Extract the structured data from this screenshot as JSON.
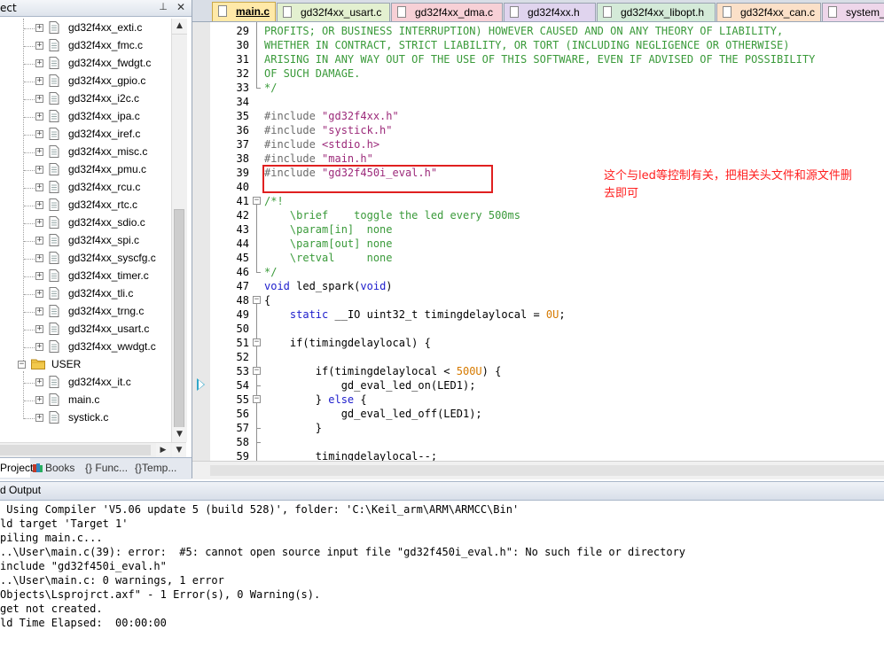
{
  "project_panel": {
    "title": "ect",
    "files": [
      {
        "name": "gd32f4xx_exti.c"
      },
      {
        "name": "gd32f4xx_fmc.c"
      },
      {
        "name": "gd32f4xx_fwdgt.c"
      },
      {
        "name": "gd32f4xx_gpio.c"
      },
      {
        "name": "gd32f4xx_i2c.c"
      },
      {
        "name": "gd32f4xx_ipa.c"
      },
      {
        "name": "gd32f4xx_iref.c"
      },
      {
        "name": "gd32f4xx_misc.c"
      },
      {
        "name": "gd32f4xx_pmu.c"
      },
      {
        "name": "gd32f4xx_rcu.c"
      },
      {
        "name": "gd32f4xx_rtc.c"
      },
      {
        "name": "gd32f4xx_sdio.c"
      },
      {
        "name": "gd32f4xx_spi.c"
      },
      {
        "name": "gd32f4xx_syscfg.c"
      },
      {
        "name": "gd32f4xx_timer.c"
      },
      {
        "name": "gd32f4xx_tli.c"
      },
      {
        "name": "gd32f4xx_trng.c"
      },
      {
        "name": "gd32f4xx_usart.c"
      },
      {
        "name": "gd32f4xx_wwdgt.c"
      }
    ],
    "group": {
      "name": "USER",
      "files": [
        {
          "name": "gd32f4xx_it.c"
        },
        {
          "name": "main.c"
        },
        {
          "name": "systick.c"
        }
      ]
    },
    "tabs": [
      {
        "label": "Project"
      },
      {
        "label": "Books"
      },
      {
        "label": "Func..."
      },
      {
        "label": "Temp..."
      }
    ]
  },
  "editor_tabs": [
    {
      "label": "main.c",
      "color": "#ffe9a8"
    },
    {
      "label": "gd32f4xx_usart.c",
      "color": "#e3f0d0"
    },
    {
      "label": "gd32f4xx_dma.c",
      "color": "#f7d0d6"
    },
    {
      "label": "gd32f4xx.h",
      "color": "#e0d4ee"
    },
    {
      "label": "gd32f4xx_libopt.h",
      "color": "#d4ead8"
    },
    {
      "label": "gd32f4xx_can.c",
      "color": "#fbe0c8"
    },
    {
      "label": "system_",
      "color": "#eed6ea"
    }
  ],
  "code": {
    "lines": [
      {
        "n": "29",
        "segments": [
          {
            "t": "PROFITS; OR BUSINESS INTERRUPTION) HOWEVER CAUSED AND ON ANY THEORY OF LIABILITY,",
            "c": "c-comment"
          }
        ]
      },
      {
        "n": "30",
        "segments": [
          {
            "t": "WHETHER IN CONTRACT, STRICT LIABILITY, OR TORT (INCLUDING NEGLIGENCE OR OTHERWISE)",
            "c": "c-comment"
          }
        ]
      },
      {
        "n": "31",
        "segments": [
          {
            "t": "ARISING IN ANY WAY OUT OF THE USE OF THIS SOFTWARE, EVEN IF ADVISED OF THE POSSIBILITY",
            "c": "c-comment"
          }
        ]
      },
      {
        "n": "32",
        "segments": [
          {
            "t": "OF SUCH DAMAGE.",
            "c": "c-comment"
          }
        ]
      },
      {
        "n": "33",
        "segments": [
          {
            "t": "*/",
            "c": "c-comment"
          }
        ]
      },
      {
        "n": "34",
        "segments": []
      },
      {
        "n": "35",
        "segments": [
          {
            "t": "#include ",
            "c": "c-pre"
          },
          {
            "t": "\"gd32f4xx.h\"",
            "c": "c-str"
          }
        ]
      },
      {
        "n": "36",
        "segments": [
          {
            "t": "#include ",
            "c": "c-pre"
          },
          {
            "t": "\"systick.h\"",
            "c": "c-str"
          }
        ]
      },
      {
        "n": "37",
        "segments": [
          {
            "t": "#include ",
            "c": "c-pre"
          },
          {
            "t": "<stdio.h>",
            "c": "c-str"
          }
        ]
      },
      {
        "n": "38",
        "segments": [
          {
            "t": "#include ",
            "c": "c-pre"
          },
          {
            "t": "\"main.h\"",
            "c": "c-str"
          }
        ]
      },
      {
        "n": "39",
        "segments": [
          {
            "t": "#include ",
            "c": "c-pre"
          },
          {
            "t": "\"gd32f450i_eval.h\"",
            "c": "c-str"
          }
        ]
      },
      {
        "n": "40",
        "segments": []
      },
      {
        "n": "41",
        "segments": [
          {
            "t": "/*!",
            "c": "c-comment"
          }
        ]
      },
      {
        "n": "42",
        "segments": [
          {
            "t": "    \\brief    toggle the led every 500ms",
            "c": "c-comment"
          }
        ]
      },
      {
        "n": "43",
        "segments": [
          {
            "t": "    \\param[in]  none",
            "c": "c-comment"
          }
        ]
      },
      {
        "n": "44",
        "segments": [
          {
            "t": "    \\param[out] none",
            "c": "c-comment"
          }
        ]
      },
      {
        "n": "45",
        "segments": [
          {
            "t": "    \\retval     none",
            "c": "c-comment"
          }
        ]
      },
      {
        "n": "46",
        "segments": [
          {
            "t": "*/",
            "c": "c-comment"
          }
        ]
      },
      {
        "n": "47",
        "segments": [
          {
            "t": "void",
            "c": "c-kw"
          },
          {
            "t": " led_spark(",
            "c": "c-plain"
          },
          {
            "t": "void",
            "c": "c-kw"
          },
          {
            "t": ")",
            "c": "c-plain"
          }
        ]
      },
      {
        "n": "48",
        "segments": [
          {
            "t": "{",
            "c": "c-plain"
          }
        ]
      },
      {
        "n": "49",
        "segments": [
          {
            "t": "    ",
            "c": "c-plain"
          },
          {
            "t": "static",
            "c": "c-kw"
          },
          {
            "t": " __IO uint32_t timingdelaylocal = ",
            "c": "c-plain"
          },
          {
            "t": "0U",
            "c": "c-num"
          },
          {
            "t": ";",
            "c": "c-plain"
          }
        ]
      },
      {
        "n": "50",
        "segments": []
      },
      {
        "n": "51",
        "segments": [
          {
            "t": "    if(timingdelaylocal) {",
            "c": "c-plain"
          }
        ]
      },
      {
        "n": "52",
        "segments": []
      },
      {
        "n": "53",
        "segments": [
          {
            "t": "        if(timingdelaylocal < ",
            "c": "c-plain"
          },
          {
            "t": "500U",
            "c": "c-num"
          },
          {
            "t": ") {",
            "c": "c-plain"
          }
        ]
      },
      {
        "n": "54",
        "segments": [
          {
            "t": "            gd_eval_led_on(LED1);",
            "c": "c-plain"
          }
        ]
      },
      {
        "n": "55",
        "segments": [
          {
            "t": "        } ",
            "c": "c-plain"
          },
          {
            "t": "else",
            "c": "c-kw"
          },
          {
            "t": " {",
            "c": "c-plain"
          }
        ]
      },
      {
        "n": "56",
        "segments": [
          {
            "t": "            gd_eval_led_off(LED1);",
            "c": "c-plain"
          }
        ]
      },
      {
        "n": "57",
        "segments": [
          {
            "t": "        }",
            "c": "c-plain"
          }
        ]
      },
      {
        "n": "58",
        "segments": []
      },
      {
        "n": "59",
        "segments": [
          {
            "t": "        timingdelaylocal--;",
            "c": "c-plain"
          }
        ]
      }
    ]
  },
  "annotation": {
    "text": "这个与led等控制有关，把相关头文件和源文件删去即可"
  },
  "build_output": {
    "title": "d Output",
    "lines": [
      " Using Compiler 'V5.06 update 5 (build 528)', folder: 'C:\\Keil_arm\\ARM\\ARMCC\\Bin'",
      "ld target 'Target 1'",
      "piling main.c...",
      "..\\User\\main.c(39): error:  #5: cannot open source input file \"gd32f450i_eval.h\": No such file or directory",
      "include \"gd32f450i_eval.h\"",
      "..\\User\\main.c: 0 warnings, 1 error",
      "Objects\\Lsprojrct.axf\" - 1 Error(s), 0 Warning(s).",
      "get not created.",
      "ld Time Elapsed:  00:00:00"
    ]
  }
}
